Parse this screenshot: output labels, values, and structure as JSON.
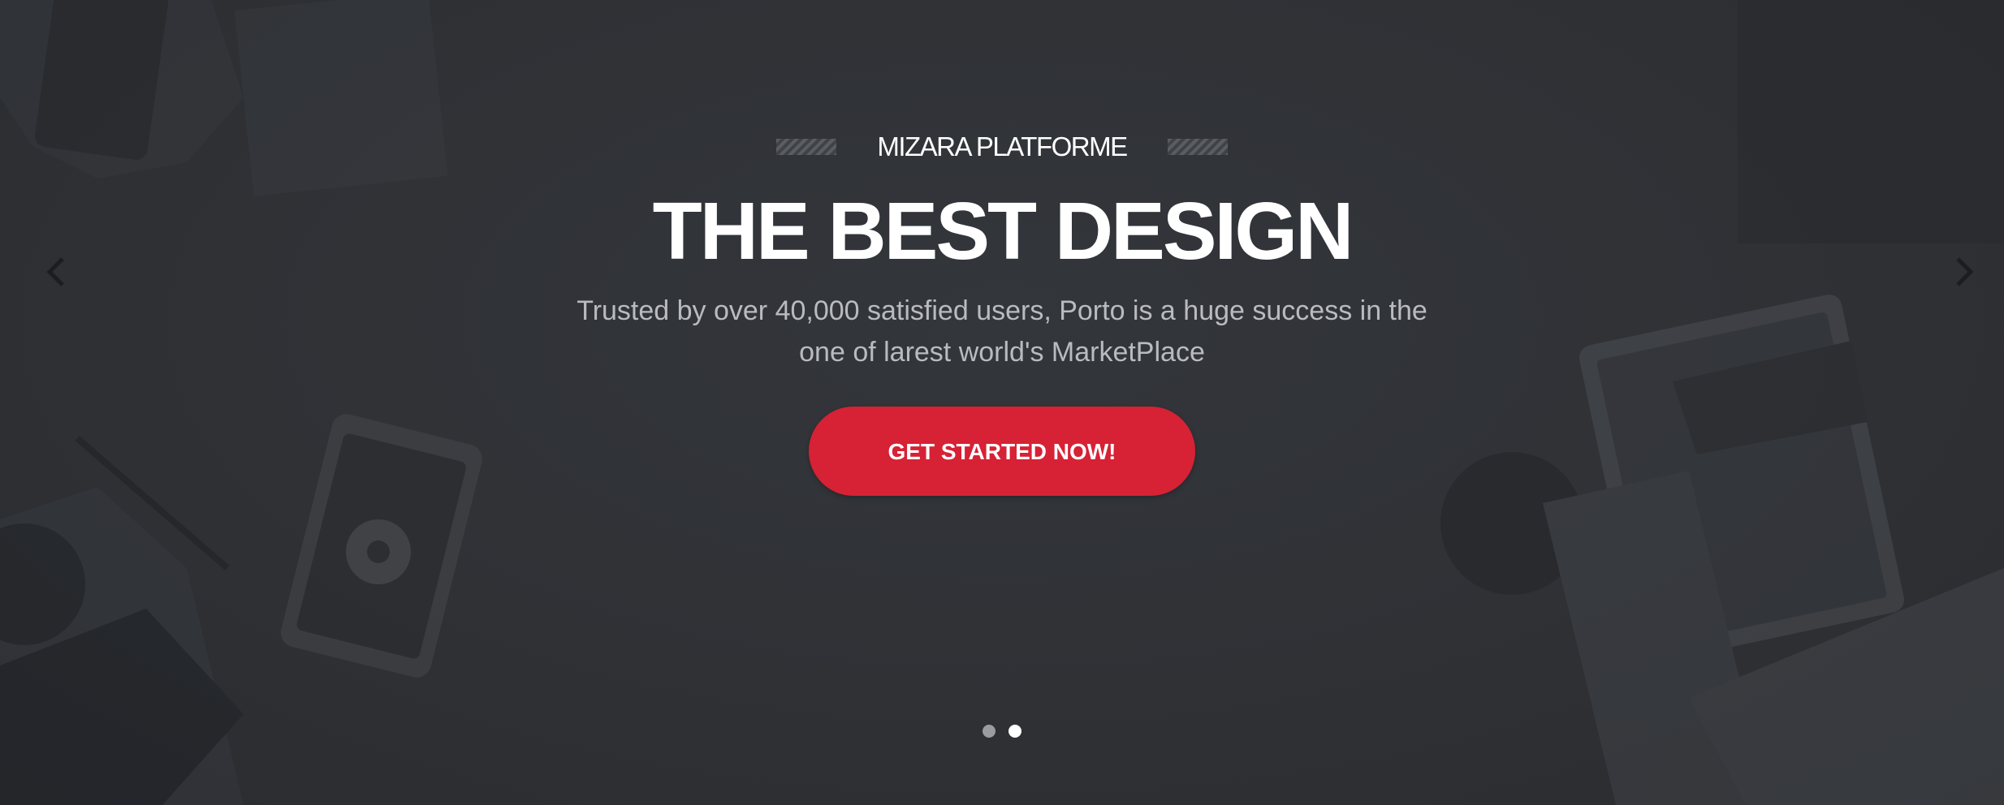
{
  "hero": {
    "eyebrow": "MIZARA PLATFORME",
    "headline": "THE BEST DESIGN",
    "subtitle_line1": "Trusted by over 40,000 satisfied users, Porto is a huge success in the",
    "subtitle_line2": "one of larest world's MarketPlace",
    "cta_label": "GET STARTED NOW!"
  },
  "slider": {
    "prev_icon": "chevron-left-icon",
    "next_icon": "chevron-right-icon",
    "slide_count": 2,
    "active_slide": 2
  },
  "colors": {
    "background": "#2e3034",
    "accent": "#d72135",
    "text_primary": "#ffffff",
    "text_secondary": "#b9bbbf"
  }
}
